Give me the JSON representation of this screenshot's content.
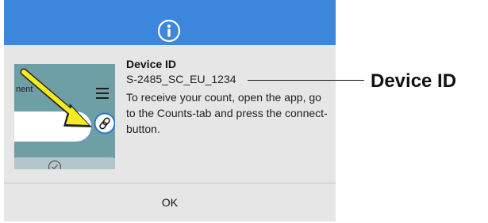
{
  "dialog": {
    "header_icon": "info-icon",
    "header_color": "#3c86dc",
    "thumbnail": {
      "label": "nent",
      "icons": [
        "menu-icon",
        "link-icon",
        "check-icon",
        "arrow-icon"
      ],
      "arrow_color": "#f3ec1e"
    },
    "title": "Device ID",
    "device_id": "S-2485_SC_EU_1234",
    "description": "To receive your count, open the app, go to the Counts-tab and press the connect-button.",
    "ok_label": "OK"
  },
  "annotation": {
    "label": "Device ID"
  }
}
